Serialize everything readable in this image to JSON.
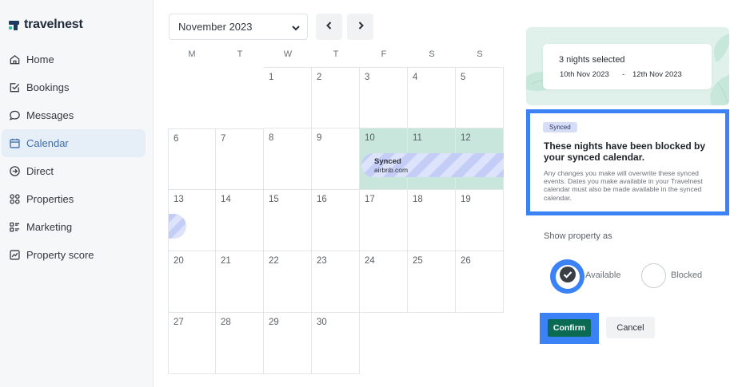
{
  "brand": {
    "name": "travelnest"
  },
  "sidebar": {
    "items": [
      {
        "label": "Home",
        "icon": "home-icon"
      },
      {
        "label": "Bookings",
        "icon": "checklist-icon"
      },
      {
        "label": "Messages",
        "icon": "chat-bubble-icon"
      },
      {
        "label": "Calendar",
        "icon": "calendar-icon",
        "active": true
      },
      {
        "label": "Direct",
        "icon": "arrow-circle-icon"
      },
      {
        "label": "Properties",
        "icon": "grid-circles-icon"
      },
      {
        "label": "Marketing",
        "icon": "filter-list-icon"
      },
      {
        "label": "Property score",
        "icon": "trend-chart-icon"
      }
    ]
  },
  "calendar": {
    "month_selected": "November 2023",
    "weekdays": [
      "M",
      "T",
      "W",
      "T",
      "F",
      "S",
      "S"
    ],
    "days": [
      "",
      "",
      "1",
      "2",
      "3",
      "4",
      "5",
      "6",
      "7",
      "8",
      "9",
      "10",
      "11",
      "12",
      "13",
      "14",
      "15",
      "16",
      "17",
      "18",
      "19",
      "20",
      "21",
      "22",
      "23",
      "24",
      "25",
      "26",
      "27",
      "28",
      "29",
      "30"
    ],
    "synced_event": {
      "label": "Synced",
      "source": "airbnb.com"
    }
  },
  "panel": {
    "summary_title": "3 nights selected",
    "date_from": "10th Nov 2023",
    "date_separator": "-",
    "date_to": "12th Nov 2023",
    "badge": "Synced",
    "info_title": "These nights have been blocked by your synced calendar.",
    "info_body": "Any changes you make will overwrite these synced events. Dates you make available in your Travelnest calendar must also be made available in the synced calendar.",
    "show_as_label": "Show property as",
    "option_available": "Available",
    "option_blocked": "Blocked",
    "selected_option": "Available",
    "confirm_label": "Confirm",
    "cancel_label": "Cancel"
  },
  "colors": {
    "accent_blue": "#3b82f6",
    "confirm_green": "#0a6b52",
    "synced_bg": "#c9e6dc",
    "summary_bg": "#dff1ea",
    "active_nav_text": "#3d6ea8"
  }
}
